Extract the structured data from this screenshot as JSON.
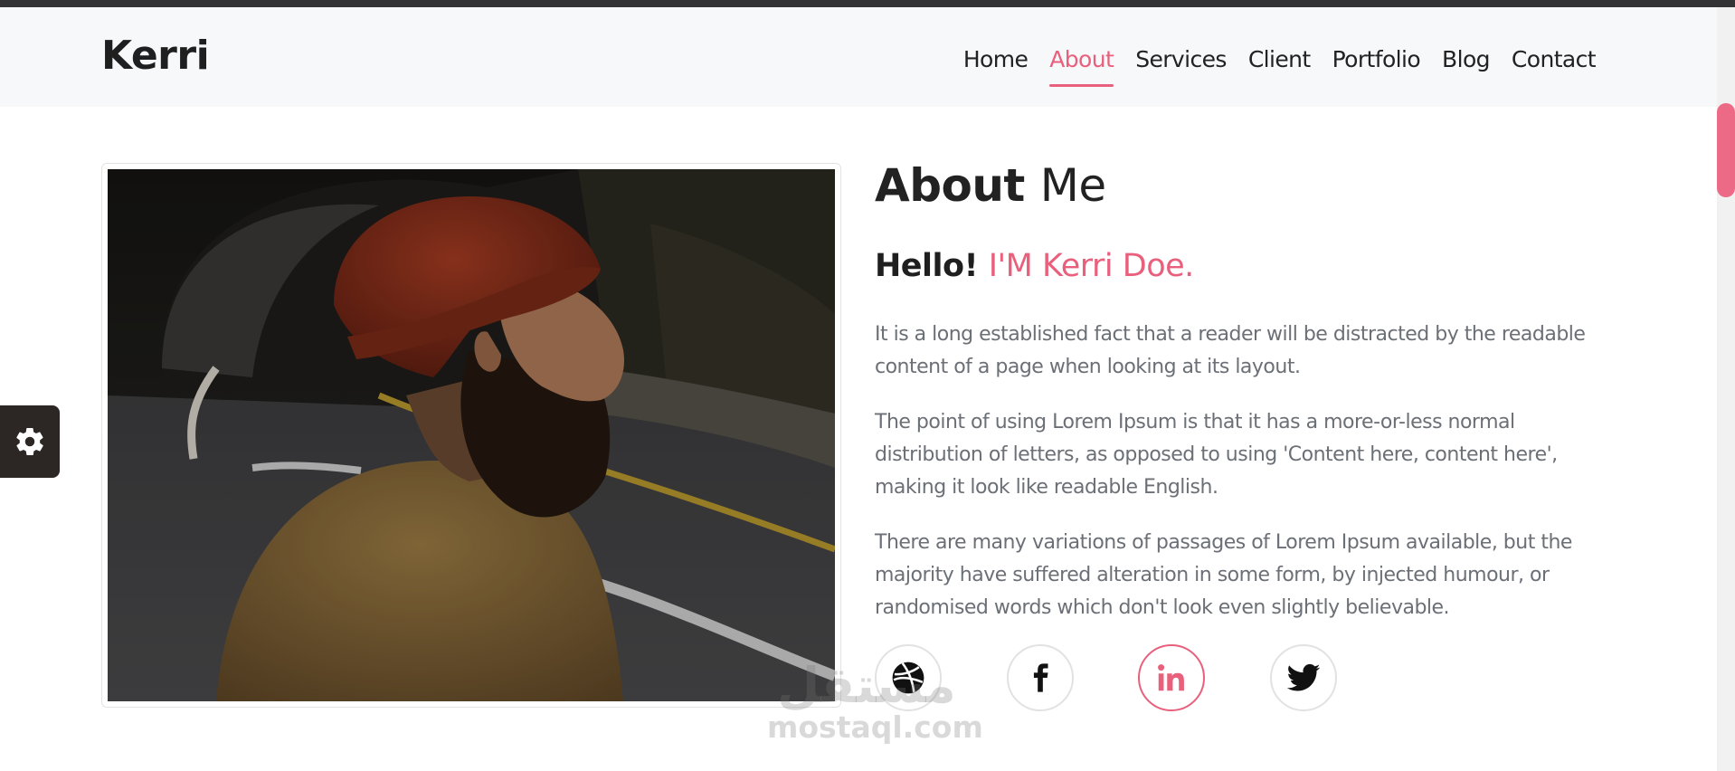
{
  "brand": "Kerri",
  "nav": {
    "items": [
      "Home",
      "About",
      "Services",
      "Client",
      "Portfolio",
      "Blog",
      "Contact"
    ],
    "active": "About"
  },
  "about": {
    "heading_bold": "About",
    "heading_light": "Me",
    "hello": "Hello!",
    "name": "I'M Kerri Doe.",
    "paragraphs": [
      "It is a long established fact that a reader will be distracted by the readable content of a page when looking at its layout.",
      "The point of using Lorem Ipsum is that it has a more-or-less normal distribution of letters, as opposed to using 'Content here, content here', making it look like readable English.",
      "There are many variations of passages of Lorem Ipsum available, but the majority have suffered alteration in some form, by injected humour, or randomised words which don't look even slightly believable."
    ]
  },
  "socials": [
    {
      "icon": "dribbble-icon",
      "active": false
    },
    {
      "icon": "facebook-icon",
      "active": false
    },
    {
      "icon": "linkedin-icon",
      "active": true
    },
    {
      "icon": "twitter-icon",
      "active": false
    }
  ],
  "watermark": {
    "arabic": "مستقل",
    "latin": "mostaql.com"
  },
  "colors": {
    "accent": "#e8607c",
    "text": "#222222",
    "muted": "#6b6f76",
    "header_bg": "#f7f8fa",
    "settings_bg": "#2c2725"
  }
}
